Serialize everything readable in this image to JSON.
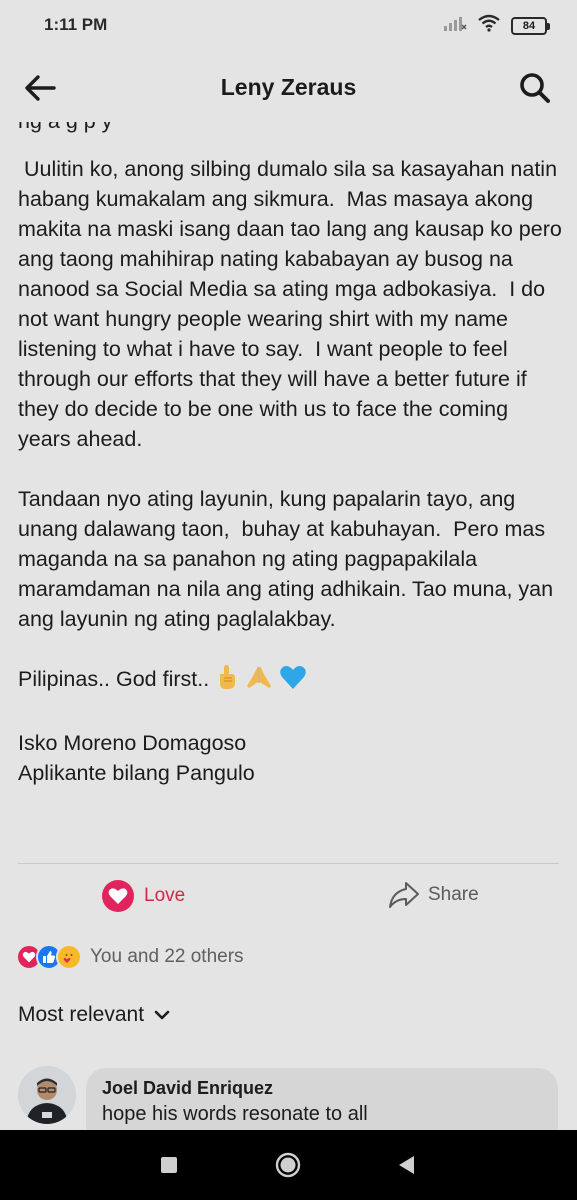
{
  "status_bar": {
    "time": "1:11 PM",
    "battery": "84"
  },
  "header": {
    "title": "Leny Zeraus"
  },
  "post": {
    "cut_line": "ng a            g  p    y",
    "paragraphs": [
      " Uulitin ko, anong silbing dumalo sila sa kasayahan natin habang kumakalam ang sikmura.  Mas masaya akong makita na maski isang daan tao lang ang kausap ko pero ang taong mahihirap nating kababayan ay busog na nanood sa Social Media sa ating mga adbokasiya.  I do not want hungry people wearing shirt with my name listening to what i have to say.  I want people to feel through our efforts that they will have a better future if they do decide to be one with us to face the coming years ahead.",
      "Tandaan nyo ating layunin, kung papalarin tayo, ang unang dalawang taon,  buhay at kabuhayan.  Pero mas maganda na sa panahon ng ating pagpapakilala maramdaman na nila ang ating adhikain. Tao muna, yan ang layunin ng ating paglalakbay."
    ],
    "closing": "Pilipinas.. God first..",
    "signature_name": "Isko Moreno Domagoso",
    "signature_title": "Aplikante bilang Pangulo"
  },
  "actions": {
    "love_label": "Love",
    "share_label": "Share"
  },
  "reactions": {
    "summary": "You and 22 others"
  },
  "sort": {
    "label": "Most relevant"
  },
  "comment": {
    "author": "Joel David Enriquez",
    "text": "hope his words resonate to all"
  },
  "colors": {
    "love": "#e0245e",
    "like": "#1877f2",
    "care": "#f7b928",
    "background": "#e4e4e4"
  }
}
